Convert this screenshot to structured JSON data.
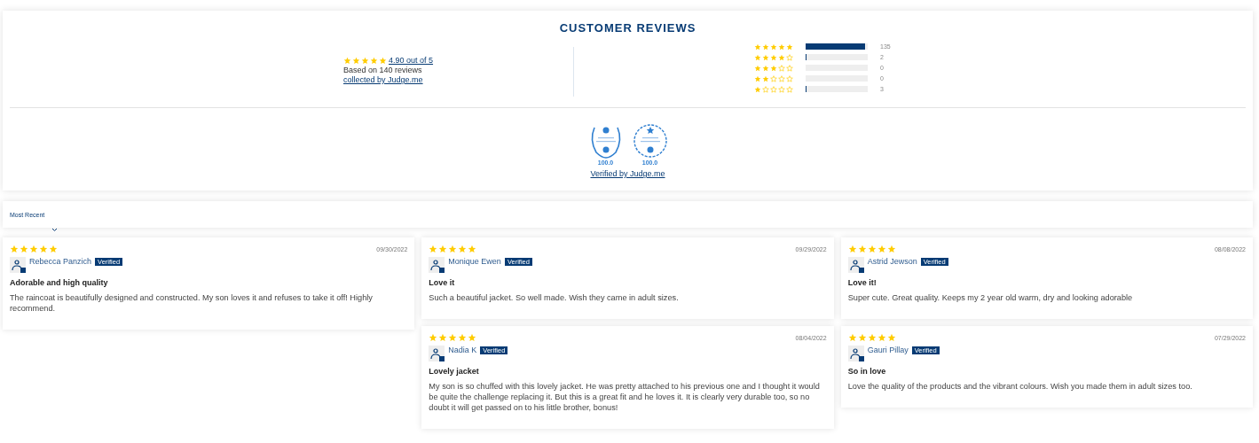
{
  "header": {
    "title": "CUSTOMER REVIEWS"
  },
  "summary": {
    "stars": 5,
    "average": "4.90 out of 5",
    "based_on": "Based on 140 reviews",
    "collected_link": "collected by Judge.me"
  },
  "histogram": [
    {
      "stars": 5,
      "level": 0.964,
      "count": "135"
    },
    {
      "stars": 4,
      "level": 0.014,
      "count": "2"
    },
    {
      "stars": 3,
      "level": 0,
      "count": "0"
    },
    {
      "stars": 2,
      "level": 0,
      "count": "0"
    },
    {
      "stars": 1,
      "level": 0.021,
      "count": "3"
    }
  ],
  "badges": [
    {
      "kind": "laurel",
      "score": "100.0"
    },
    {
      "kind": "ring",
      "score": "100.0"
    }
  ],
  "verified_link": "Verified by Judge.me",
  "sort": {
    "label": "Most Recent"
  },
  "columns": [
    [
      {
        "stars": 5,
        "date": "09/30/2022",
        "name": "Rebecca Panzich",
        "verified": true,
        "verified_label": "Verified",
        "title": "Adorable and high quality",
        "body": "The raincoat is beautifully designed and constructed. My son loves it and refuses to take it off! Highly recommend."
      }
    ],
    [
      {
        "stars": 5,
        "date": "09/29/2022",
        "name": "Monique Ewen",
        "verified": true,
        "verified_label": "Verified",
        "title": "Love it",
        "body": "Such a beautiful jacket. So well made. Wish they came in adult sizes."
      },
      {
        "stars": 5,
        "date": "08/04/2022",
        "name": "Nadia K",
        "verified": true,
        "verified_label": "Verified",
        "title": "Lovely jacket",
        "body": "My son is so chuffed with this lovely jacket. He was pretty attached to his previous one and I thought it would be quite the challenge replacing it. But this is a great fit and he loves it. It is clearly very durable too, so no doubt it will get passed on to his little brother, bonus!"
      }
    ],
    [
      {
        "stars": 5,
        "date": "08/08/2022",
        "name": "Astrid Jewson",
        "verified": true,
        "verified_label": "Verified",
        "title": "Love it!",
        "body": "Super cute. Great quality. Keeps my 2 year old warm, dry and looking adorable"
      },
      {
        "stars": 5,
        "date": "07/29/2022",
        "name": "Gauri Pillay",
        "verified": true,
        "verified_label": "Verified",
        "title": "So in love",
        "body": "Love the quality of the products and the vibrant colours. Wish you made them in adult sizes too."
      }
    ]
  ]
}
